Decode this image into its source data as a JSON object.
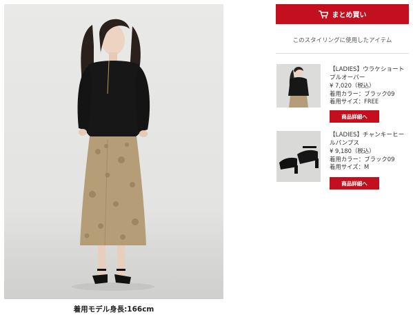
{
  "styling": {
    "caption": "着用モデル身長:166cm"
  },
  "sidebar": {
    "buy_all_label": "まとめ買い",
    "section_title": "このスタイリングに使用したアイテム",
    "items": [
      {
        "name": "【LADIES】ウラケショートプルオーバー",
        "price": "¥ 7,020（税込）",
        "color": "着用カラー：ブラック09",
        "size": "着用サイズ：FREE",
        "button": "商品詳細へ"
      },
      {
        "name": "【LADIES】チャンキーヒールパンプス",
        "price": "¥ 9,180（税込）",
        "color": "着用カラー：ブラック09",
        "size": "着用サイズ：M",
        "button": "商品詳細へ"
      }
    ]
  },
  "colors": {
    "accent": "#c40f1f",
    "background": "#ffffff"
  },
  "icons": {
    "cart": "cart-icon"
  }
}
